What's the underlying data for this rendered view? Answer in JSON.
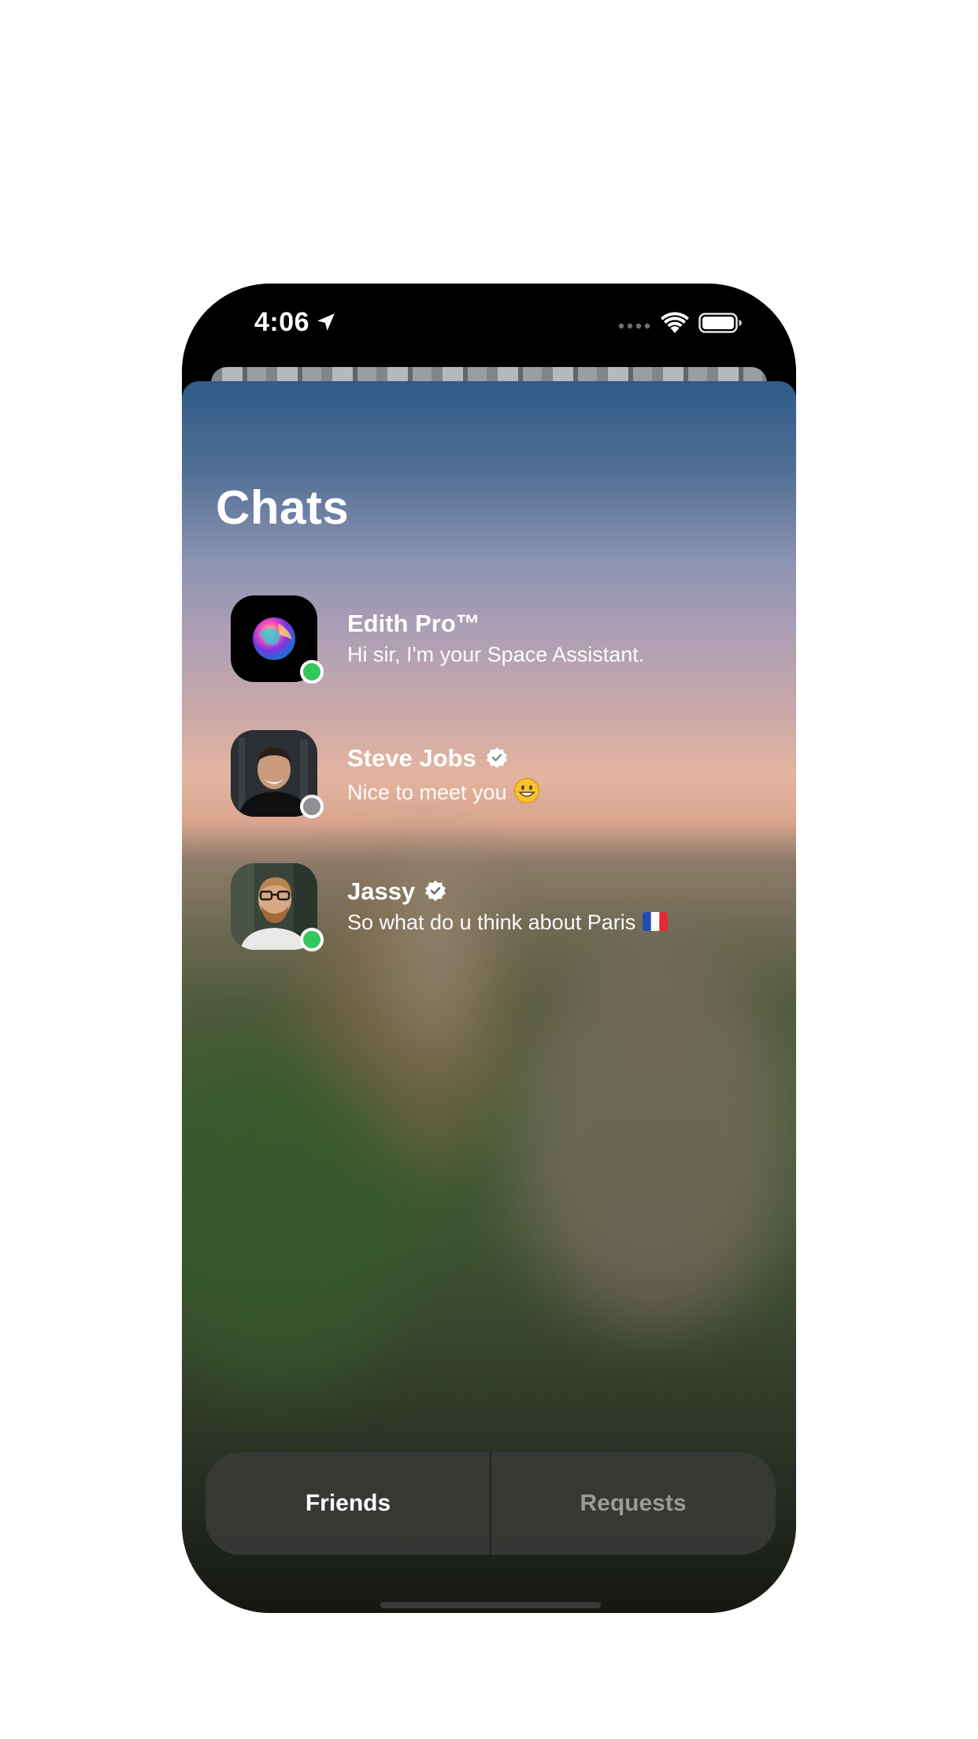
{
  "status_bar": {
    "time": "4:06",
    "location_icon": "location-arrow-icon",
    "signal_icon": "signal-dots-icon",
    "wifi_icon": "wifi-icon",
    "battery_icon": "battery-icon"
  },
  "header": {
    "title": "Chats"
  },
  "chats": [
    {
      "name": "Edith Pro™",
      "preview": "Hi sir, I'm your Space Assistant.",
      "verified": false,
      "status": "online",
      "status_color": "#34c759",
      "avatar_icon": "globe-icon"
    },
    {
      "name": "Steve Jobs",
      "preview": "Nice to meet you",
      "preview_emoji": "grinning-face-icon",
      "verified": true,
      "status": "offline",
      "status_color": "#8e8e93",
      "avatar_icon": "user-photo"
    },
    {
      "name": "Jassy",
      "preview": "So what do u think about Paris",
      "preview_emoji": "france-flag-icon",
      "verified": true,
      "status": "online",
      "status_color": "#34c759",
      "avatar_icon": "user-photo"
    }
  ],
  "tabs": {
    "friends_label": "Friends",
    "requests_label": "Requests",
    "active": "Friends"
  },
  "colors": {
    "online": "#34c759",
    "offline": "#8e8e93",
    "active_tab_text": "#ffffff",
    "inactive_tab_text": "#9a9a98"
  }
}
